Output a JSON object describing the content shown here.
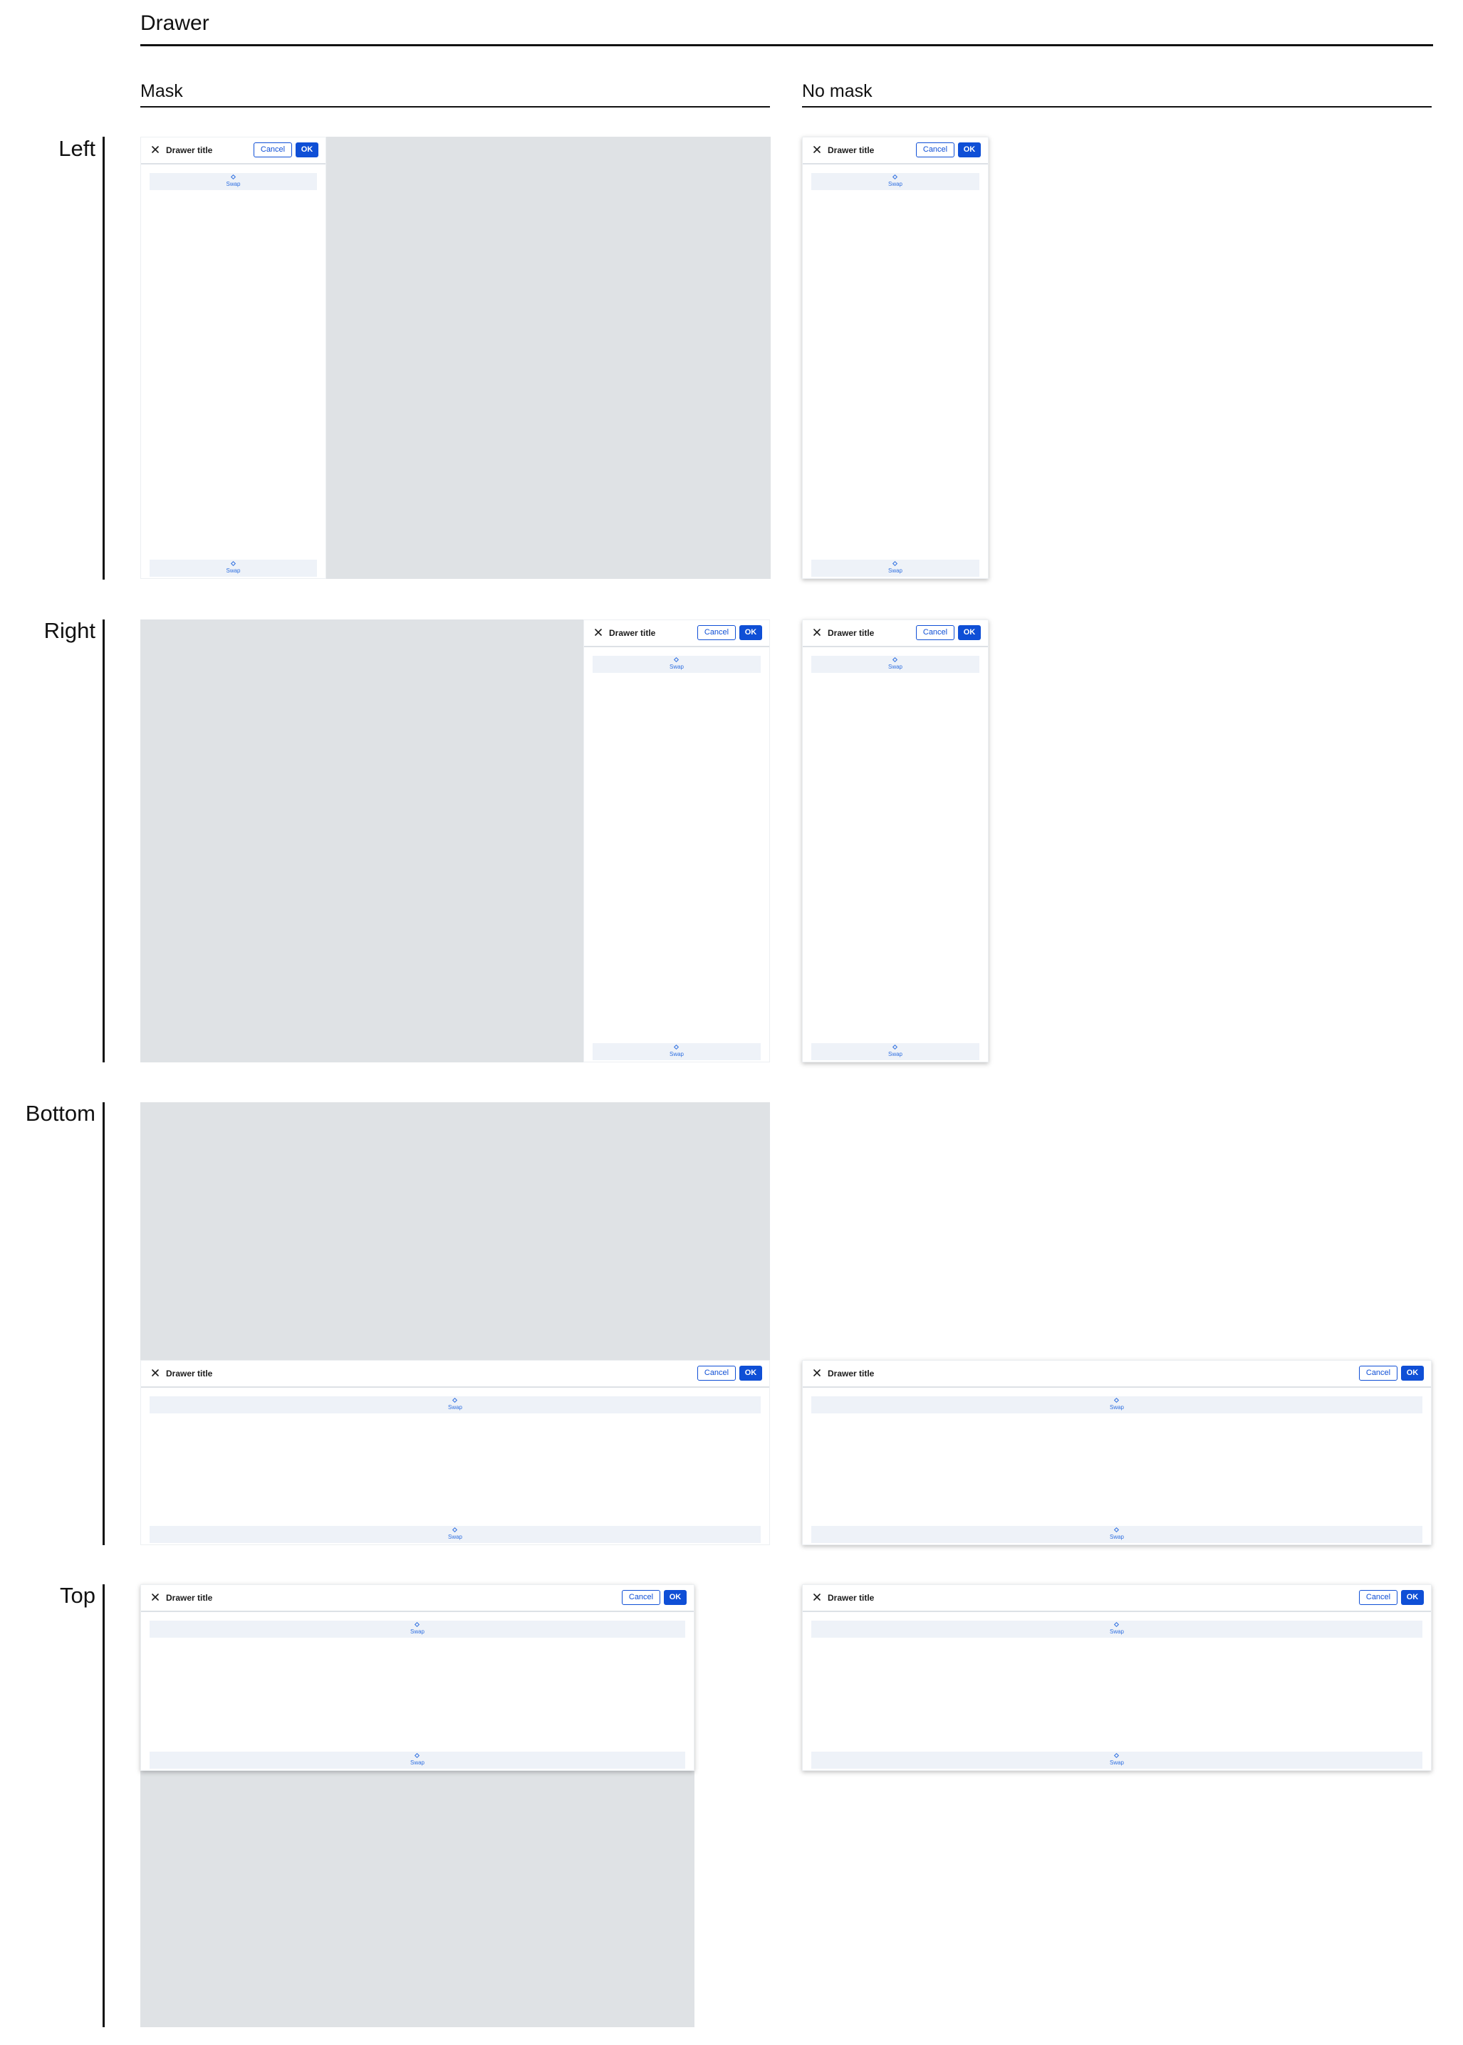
{
  "page": {
    "title": "Drawer",
    "columns": {
      "mask": "Mask",
      "no_mask": "No mask"
    }
  },
  "rows": {
    "left": "Left",
    "right": "Right",
    "bottom": "Bottom",
    "top": "Top"
  },
  "drawer": {
    "title": "Drawer title",
    "cancel_label": "Cancel",
    "ok_label": "OK",
    "close_icon": "close-icon",
    "slot_label": "Swap",
    "slot_icon": "diamond-icon"
  },
  "colors": {
    "accent": "#0f4fd6",
    "mask": "#dfe2e5",
    "slot_bg": "#eef2f8",
    "slot_text": "#2f6fe0"
  }
}
